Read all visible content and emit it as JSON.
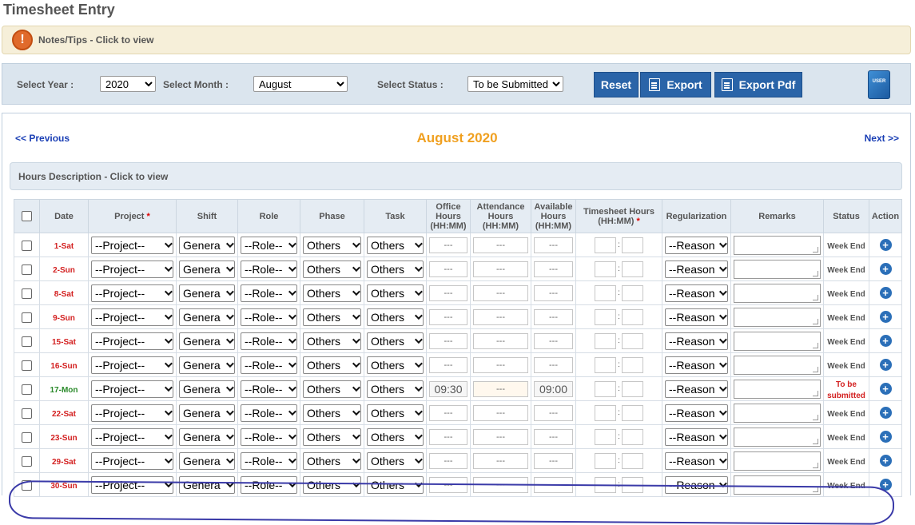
{
  "page": {
    "title": "Timesheet Entry"
  },
  "notes": {
    "icon": "!",
    "label": "Notes/Tips - Click to view"
  },
  "filters": {
    "year_label": "Select Year :",
    "year_value": "2020",
    "month_label": "Select Month :",
    "month_value": "August",
    "status_label": "Select Status :",
    "status_value": "To be Submitted"
  },
  "toolbar": {
    "reset_label": "Reset",
    "export_label": "Export",
    "export_pdf_label": "Export Pdf",
    "user_manual_text": "USER"
  },
  "nav": {
    "previous_label": "<< Previous",
    "next_label": "Next >>",
    "month_title": "August 2020"
  },
  "hours_description": {
    "label": "Hours Description - Click to view"
  },
  "table": {
    "headers": {
      "date": "Date",
      "project": "Project",
      "required_mark": "*",
      "shift": "Shift",
      "role": "Role",
      "phase": "Phase",
      "task": "Task",
      "office_hours_1": "Office",
      "office_hours_2": "Hours",
      "office_hours_3": "(HH:MM)",
      "attendance_hours_1": "Attendance",
      "attendance_hours_2": "Hours",
      "attendance_hours_3": "(HH:MM)",
      "available_hours_1": "Available",
      "available_hours_2": "Hours",
      "available_hours_3": "(HH:MM)",
      "timesheet_hours_1": "Timesheet Hours",
      "timesheet_hours_2": "(HH:MM)",
      "regularization": "Regularization",
      "remarks": "Remarks",
      "status": "Status",
      "action": "Action"
    },
    "colon": ":",
    "action_icon": "+",
    "rows": [
      {
        "date": "1-Sat",
        "project": "--Project--",
        "shift": "Genera",
        "role": "--Role--",
        "phase": "Others",
        "task": "Others",
        "office": "---",
        "attendance": "---",
        "available": "---",
        "regularization": "--Reason",
        "status": "Week End"
      },
      {
        "date": "2-Sun",
        "project": "--Project--",
        "shift": "Genera",
        "role": "--Role--",
        "phase": "Others",
        "task": "Others",
        "office": "---",
        "attendance": "---",
        "available": "---",
        "regularization": "--Reason",
        "status": "Week End"
      },
      {
        "date": "8-Sat",
        "project": "--Project--",
        "shift": "Genera",
        "role": "--Role--",
        "phase": "Others",
        "task": "Others",
        "office": "---",
        "attendance": "---",
        "available": "---",
        "regularization": "--Reason",
        "status": "Week End"
      },
      {
        "date": "9-Sun",
        "project": "--Project--",
        "shift": "Genera",
        "role": "--Role--",
        "phase": "Others",
        "task": "Others",
        "office": "---",
        "attendance": "---",
        "available": "---",
        "regularization": "--Reason",
        "status": "Week End"
      },
      {
        "date": "15-Sat",
        "project": "--Project--",
        "shift": "Genera",
        "role": "--Role--",
        "phase": "Others",
        "task": "Others",
        "office": "---",
        "attendance": "---",
        "available": "---",
        "regularization": "--Reason",
        "status": "Week End"
      },
      {
        "date": "16-Sun",
        "project": "--Project--",
        "shift": "Genera",
        "role": "--Role--",
        "phase": "Others",
        "task": "Others",
        "office": "---",
        "attendance": "---",
        "available": "---",
        "regularization": "--Reason",
        "status": "Week End"
      },
      {
        "date": "17-Mon",
        "project": "--Project--",
        "shift": "Genera",
        "role": "--Role--",
        "phase": "Others",
        "task": "Others",
        "office": "09:30",
        "attendance": "---",
        "available": "09:00",
        "regularization": "--Reason",
        "status": "To be submitted"
      },
      {
        "date": "22-Sat",
        "project": "--Project--",
        "shift": "Genera",
        "role": "--Role--",
        "phase": "Others",
        "task": "Others",
        "office": "---",
        "attendance": "---",
        "available": "---",
        "regularization": "--Reason",
        "status": "Week End"
      },
      {
        "date": "23-Sun",
        "project": "--Project--",
        "shift": "Genera",
        "role": "--Role--",
        "phase": "Others",
        "task": "Others",
        "office": "---",
        "attendance": "---",
        "available": "---",
        "regularization": "--Reason",
        "status": "Week End"
      },
      {
        "date": "29-Sat",
        "project": "--Project--",
        "shift": "Genera",
        "role": "--Role--",
        "phase": "Others",
        "task": "Others",
        "office": "---",
        "attendance": "---",
        "available": "---",
        "regularization": "--Reason",
        "status": "Week End"
      },
      {
        "date": "30-Sun",
        "project": "--Project--",
        "shift": "Genera",
        "role": "--Role--",
        "phase": "Others",
        "task": "Others",
        "office": "---",
        "attendance": "---",
        "available": "---",
        "regularization": "--Reason",
        "status": "Week End"
      }
    ]
  },
  "colors": {
    "accent_blue": "#2a64a8",
    "month_title": "#f0a020",
    "weekend_date": "#d32020",
    "weekday_date": "#2a8a2a",
    "annotation": "#3a3aa8"
  }
}
